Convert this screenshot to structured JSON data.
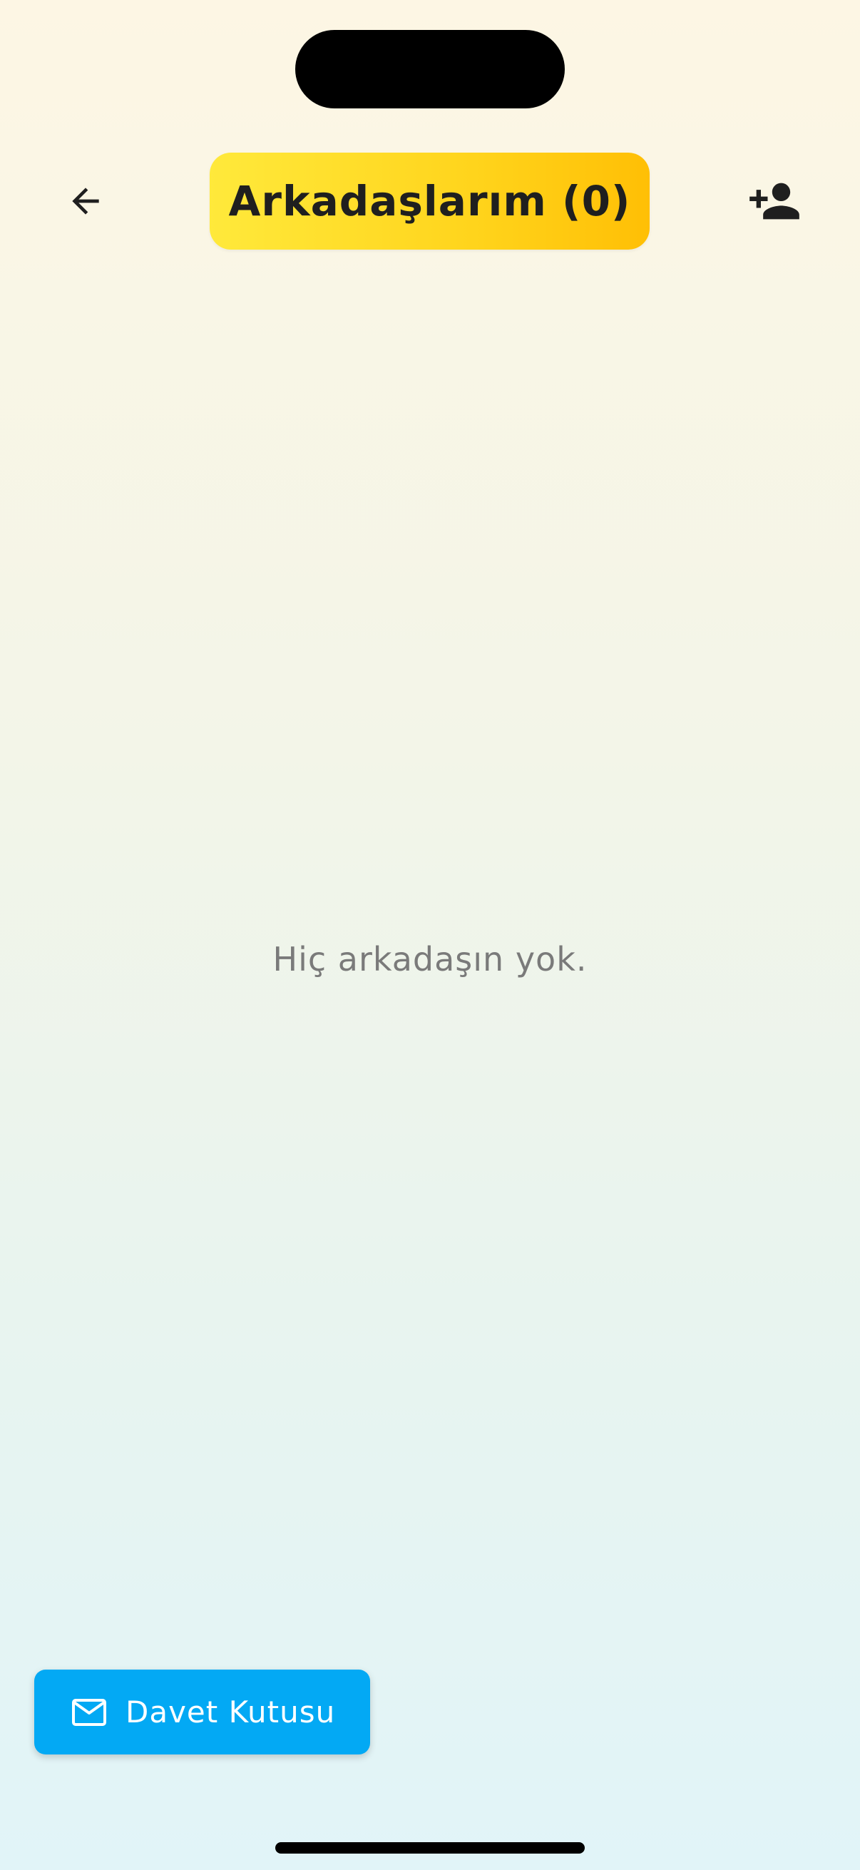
{
  "header": {
    "title": "Arkadaşlarım (0)",
    "back_icon": "arrow-left-icon",
    "add_friend_icon": "person-add-icon"
  },
  "main": {
    "empty_message": "Hiç arkadaşın yok."
  },
  "footer": {
    "invite_button_label": "Davet Kutusu",
    "invite_icon": "mail-icon"
  },
  "colors": {
    "title_pill_start": "#ffe93b",
    "title_pill_end": "#ffbf05",
    "invite_button": "#03a9f4",
    "empty_text": "#7a7a7a"
  }
}
